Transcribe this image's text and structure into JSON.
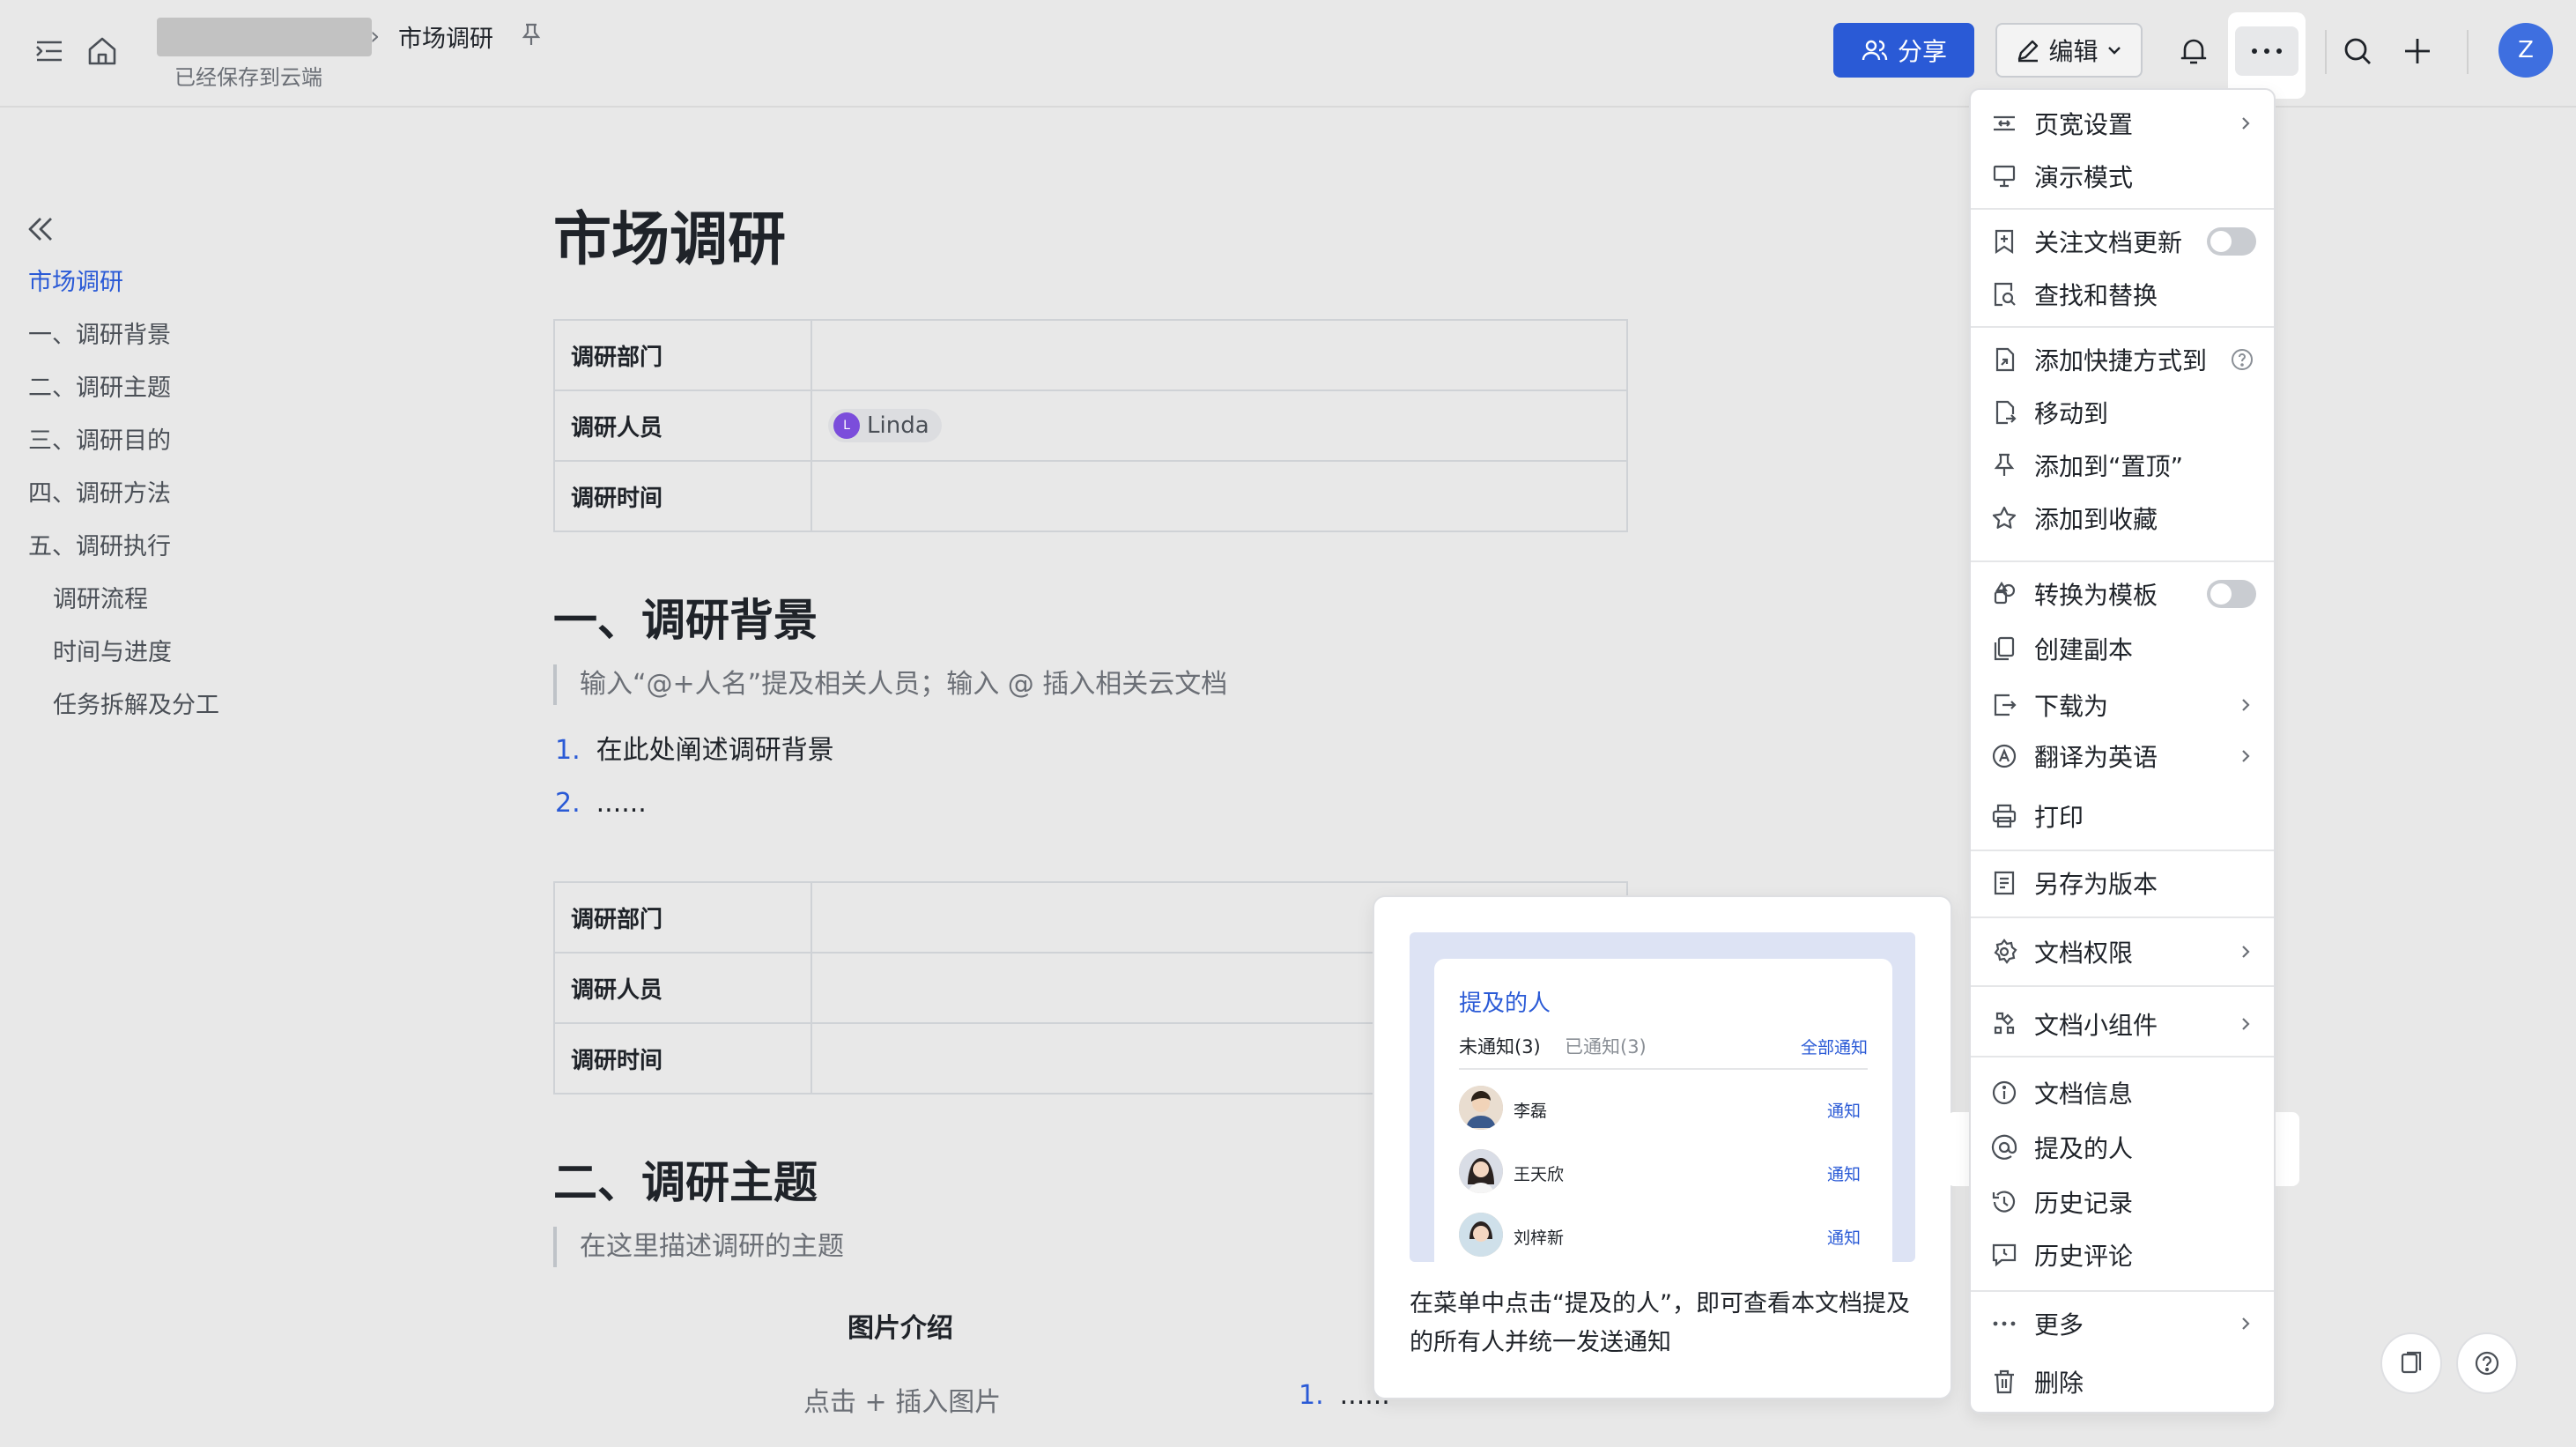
{
  "header": {
    "breadcrumb_title": "市场调研",
    "saved_status": "已经保存到云端",
    "share_label": "分享",
    "edit_label": "编辑",
    "avatar_initial": "Z"
  },
  "outline": {
    "items": [
      {
        "label": "市场调研"
      },
      {
        "label": "一、调研背景"
      },
      {
        "label": "二、调研主题"
      },
      {
        "label": "三、调研目的"
      },
      {
        "label": "四、调研方法"
      },
      {
        "label": "五、调研执行"
      },
      {
        "label": "调研流程"
      },
      {
        "label": "时间与进度"
      },
      {
        "label": "任务拆解及分工"
      }
    ]
  },
  "doc": {
    "title": "市场调研",
    "table1": {
      "rows": [
        {
          "key": "调研部门",
          "value": ""
        },
        {
          "key": "调研人员",
          "value": "Linda",
          "chip_initial": "L"
        },
        {
          "key": "调研时间",
          "value": ""
        }
      ]
    },
    "section1": {
      "heading": "一、调研背景",
      "quote": "输入“@+人名”提及相关人员；输入 @ 插入相关云文档",
      "list": [
        {
          "num": "1.",
          "text": "在此处阐述调研背景"
        },
        {
          "num": "2.",
          "text": "......"
        }
      ]
    },
    "table2": {
      "rows": [
        {
          "key": "调研部门"
        },
        {
          "key": "调研人员"
        },
        {
          "key": "调研时间"
        }
      ]
    },
    "section2": {
      "heading": "二、调研主题",
      "quote": "在这里描述调研的主题",
      "image_caption": "图片介绍",
      "image_placeholder": "点击 + 插入图片",
      "list_num": "1.",
      "list_text": "......"
    }
  },
  "menu": {
    "items": [
      {
        "label": "页宽设置"
      },
      {
        "label": "演示模式"
      },
      {
        "label": "关注文档更新"
      },
      {
        "label": "查找和替换"
      },
      {
        "label": "添加快捷方式到"
      },
      {
        "label": "移动到"
      },
      {
        "label": "添加到“置顶”"
      },
      {
        "label": "添加到收藏"
      },
      {
        "label": "转换为模板"
      },
      {
        "label": "创建副本"
      },
      {
        "label": "下载为"
      },
      {
        "label": "翻译为英语"
      },
      {
        "label": "打印"
      },
      {
        "label": "另存为版本"
      },
      {
        "label": "文档权限"
      },
      {
        "label": "文档小组件"
      },
      {
        "label": "文档信息"
      },
      {
        "label": "提及的人"
      },
      {
        "label": "历史记录"
      },
      {
        "label": "历史评论"
      },
      {
        "label": "更多"
      },
      {
        "label": "删除"
      }
    ]
  },
  "popover": {
    "card_title": "提及的人",
    "tab_unnotified": "未通知(3)",
    "tab_notified": "已通知(3)",
    "notify_all": "全部通知",
    "people": [
      {
        "name": "李磊",
        "action": "通知"
      },
      {
        "name": "王天欣",
        "action": "通知"
      },
      {
        "name": "刘梓新",
        "action": "通知"
      }
    ],
    "description": "在菜单中点击“提及的人”，即可查看本文档提及的所有人并统一发送通知"
  },
  "colors": {
    "accent": "#2a5ad6",
    "page_bg": "#e8e8e8"
  }
}
